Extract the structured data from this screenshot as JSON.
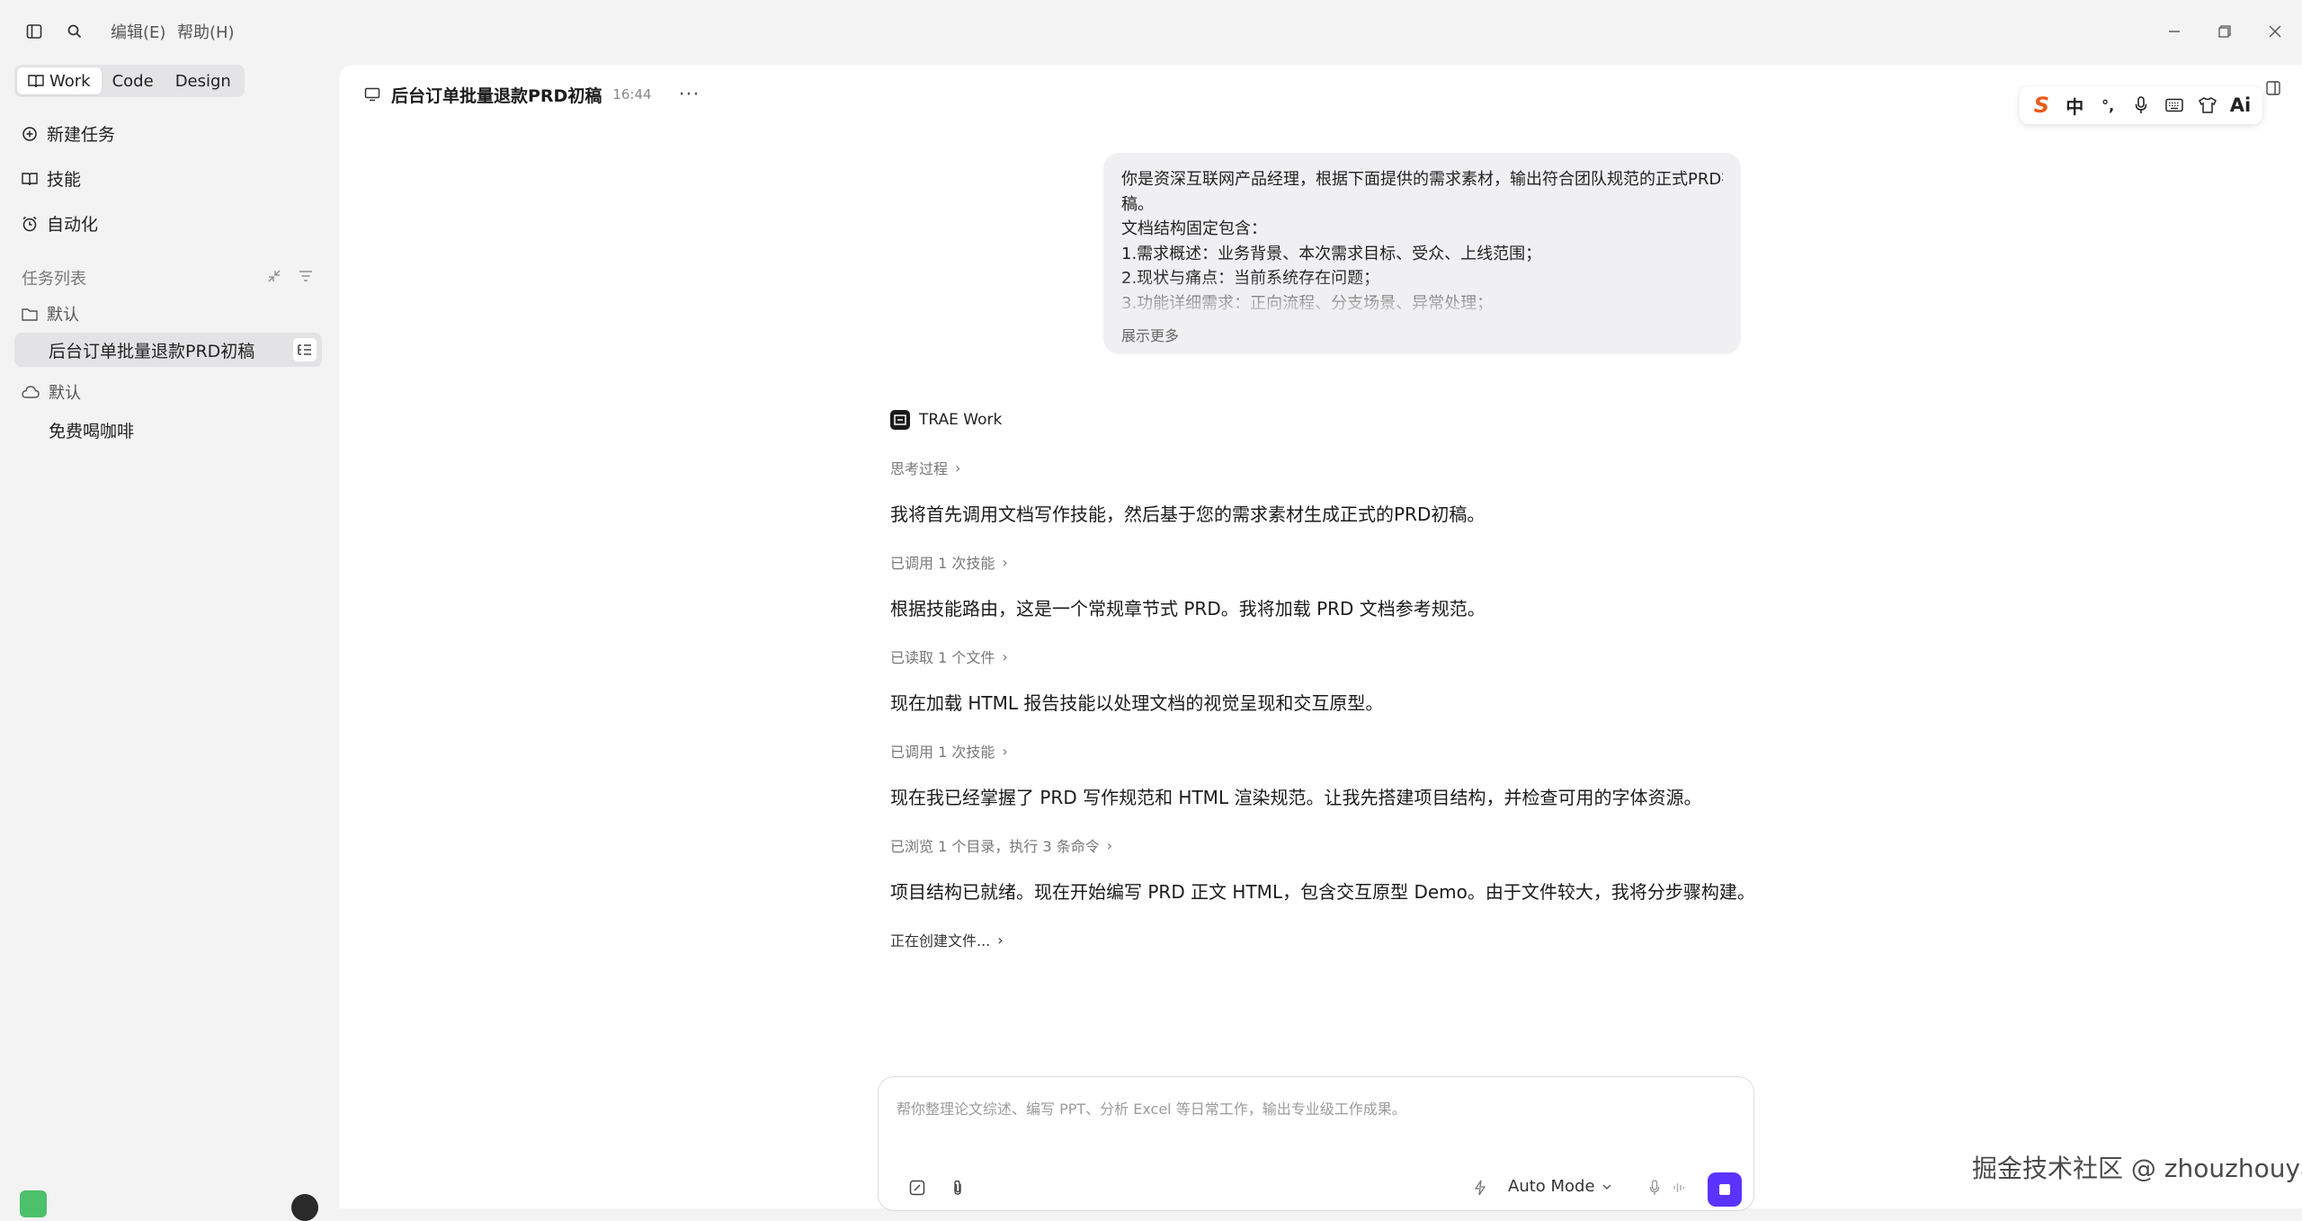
{
  "topbar": {
    "menu": [
      "编辑(E)",
      "帮助(H)"
    ],
    "icons": [
      "sidebar-toggle-icon",
      "search-icon"
    ]
  },
  "sidebar": {
    "modes": [
      "Work",
      "Code",
      "Design"
    ],
    "active_mode": "Work",
    "nav": [
      {
        "label": "新建任务",
        "icon": "new-task-icon"
      },
      {
        "label": "技能",
        "icon": "book-icon"
      },
      {
        "label": "自动化",
        "icon": "alarm-icon"
      }
    ],
    "task_list_title": "任务列表",
    "groups": [
      {
        "label": "默认",
        "icon": "folder-icon",
        "tasks": [
          "后台订单批量退款PRD初稿"
        ]
      },
      {
        "label": "默认",
        "icon": "cloud-icon",
        "tasks": [
          "免费喝咖啡"
        ]
      }
    ]
  },
  "header": {
    "title": "后台订单批量退款PRD初稿",
    "time": "16:44",
    "more": "···"
  },
  "ime": [
    "S",
    "中",
    "°,",
    "mic",
    "keyboard",
    "shirt",
    "Ai"
  ],
  "user_message": {
    "lines": [
      "你是资深互联网产品经理，根据下面提供的需求素材，输出符合团队规范的正式PRD初",
      "稿。",
      "文档结构固定包含：",
      "1.需求概述：业务背景、本次需求目标、受众、上线范围；",
      "2.现状与痛点：当前系统存在问题；",
      "3.功能详细需求：正向流程、分支场景、异常处理；"
    ],
    "show_more": "展示更多"
  },
  "agent": {
    "name": "TRAE Work",
    "steps": [
      {
        "step": "思考过程",
        "msg": "我将首先调用文档写作技能，然后基于您的需求素材生成正式的PRD初稿。"
      },
      {
        "step": "已调用 1 次技能",
        "msg": "根据技能路由，这是一个常规章节式 PRD。我将加载 PRD 文档参考规范。"
      },
      {
        "step": "已读取 1 个文件",
        "msg": "现在加载 HTML 报告技能以处理文档的视觉呈现和交互原型。"
      },
      {
        "step": "已调用 1 次技能",
        "msg": "现在我已经掌握了 PRD 写作规范和 HTML 渲染规范。让我先搭建项目结构，并检查可用的字体资源。"
      },
      {
        "step": "已浏览 1 个目录，执行 3 条命令",
        "msg": "项目结构已就绪。现在开始编写 PRD 正文 HTML，包含交互原型 Demo。由于文件较大，我将分步骤构建。"
      }
    ],
    "creating": "正在创建文件..."
  },
  "input": {
    "placeholder": "帮你整理论文综述、编写 PPT、分析 Excel 等日常工作，输出专业级工作成果。",
    "mode": "Auto Mode"
  },
  "watermark": "掘金技术社区 @ zhouzhouya",
  "colors": {
    "accent": "#5b33ff",
    "sidebar_bg": "#f3f3f4",
    "bubble_bg": "#f0f0f2"
  }
}
